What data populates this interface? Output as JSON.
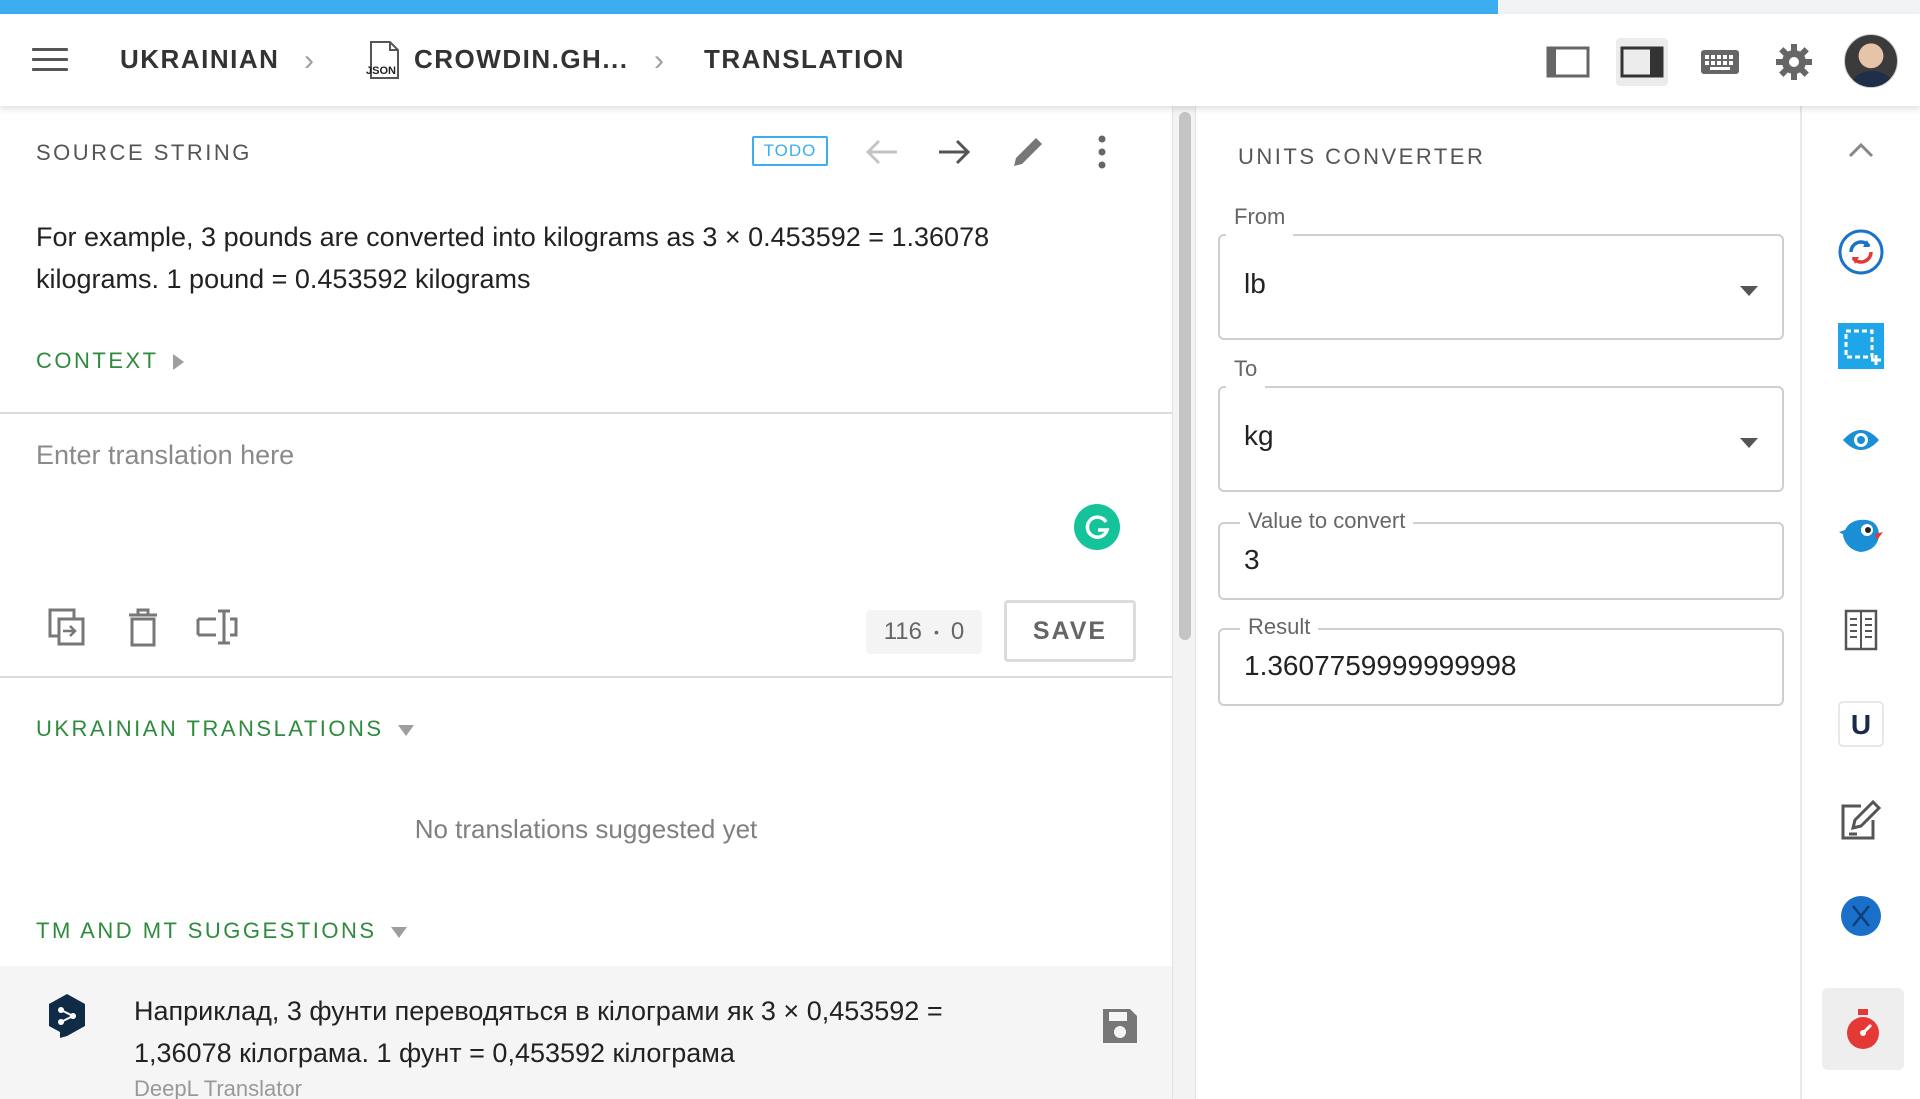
{
  "progress": {
    "fraction": 0.78,
    "color": "#3dadf2"
  },
  "topbar": {
    "breadcrumb": [
      "UKRAINIAN",
      "CROWDIN.GH...",
      "TRANSLATION"
    ],
    "file_icon_label": "JSON",
    "icons": [
      "menu-icon",
      "layout-left-panel-icon",
      "layout-right-panel-icon",
      "keyboard-icon",
      "gear-icon",
      "avatar"
    ]
  },
  "source": {
    "header": "SOURCE STRING",
    "status_badge": "TODO",
    "text": "For example, 3 pounds are converted into kilograms as 3 × 0.453592 = 1.36078 kilograms. 1 pound = 0.453592 kilograms",
    "context_label": "CONTEXT"
  },
  "editor": {
    "placeholder": "Enter translation here",
    "char_count": "116",
    "dot": "•",
    "count2": "0",
    "save_label": "SAVE"
  },
  "translations": {
    "header": "UKRAINIAN TRANSLATIONS",
    "empty_text": "No translations suggested yet"
  },
  "suggestions": {
    "header": "TM AND MT SUGGESTIONS",
    "items": [
      {
        "text": "Наприклад, 3 фунти переводяться в кілограми як 3 × 0,453592 = 1,36078 кілограма. 1 фунт = 0,453592 кілограма",
        "source": "DeepL Translator"
      }
    ]
  },
  "converter": {
    "title": "UNITS CONVERTER",
    "from_label": "From",
    "from_value": "lb",
    "to_label": "To",
    "to_value": "kg",
    "value_label": "Value to convert",
    "value": "3",
    "result_label": "Result",
    "result": "1.3607759999999998"
  },
  "rail": {
    "icons": [
      "chevron-up-icon",
      "sync-icon",
      "screenshot-icon",
      "eye-icon",
      "bird-app-icon",
      "book-icon",
      "u-app-icon",
      "edit-note-icon",
      "globe-icon",
      "timer-icon"
    ],
    "single_letter": "U"
  },
  "colors": {
    "accent_blue": "#3dadf2",
    "green": "#2e8b3e",
    "grammarly": "#15c39a"
  }
}
